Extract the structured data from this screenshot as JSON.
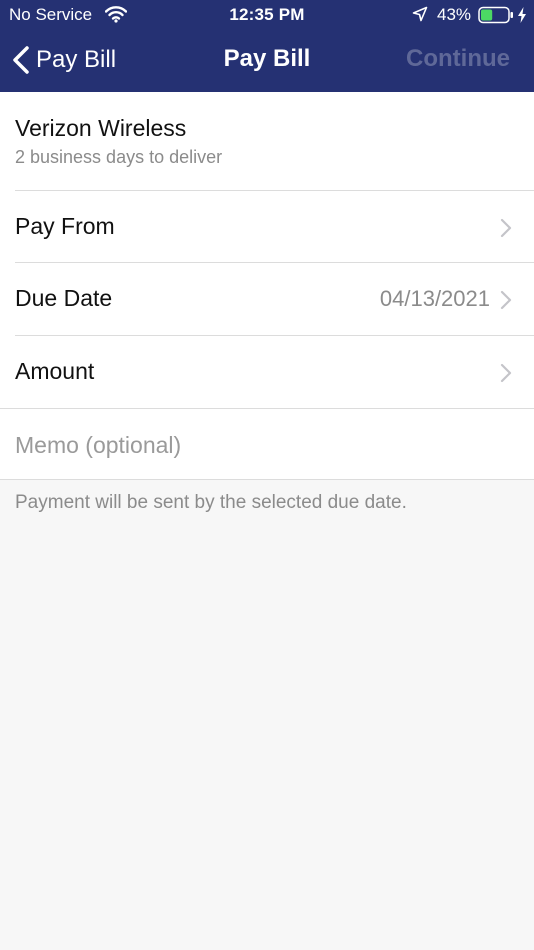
{
  "status_bar": {
    "carrier": "No Service",
    "time": "12:35 PM",
    "battery_percent": "43%",
    "battery_level": 0.43,
    "battery_color": "#4cd964",
    "icons": [
      "wifi-icon",
      "location-arrow-icon",
      "battery-icon",
      "charging-bolt-icon"
    ]
  },
  "nav": {
    "back_label": "Pay Bill",
    "title": "Pay Bill",
    "continue_label": "Continue",
    "bar_color": "#253173",
    "continue_disabled_color": "#5f6898"
  },
  "payee": {
    "name": "Verizon Wireless",
    "delivery": "2 business days to deliver"
  },
  "rows": [
    {
      "label": "Pay From",
      "value": ""
    },
    {
      "label": "Due Date",
      "value": "04/13/2021"
    },
    {
      "label": "Amount",
      "value": ""
    }
  ],
  "memo": {
    "placeholder": "Memo (optional)",
    "value": ""
  },
  "footer_note": "Payment will be sent by the selected due date."
}
